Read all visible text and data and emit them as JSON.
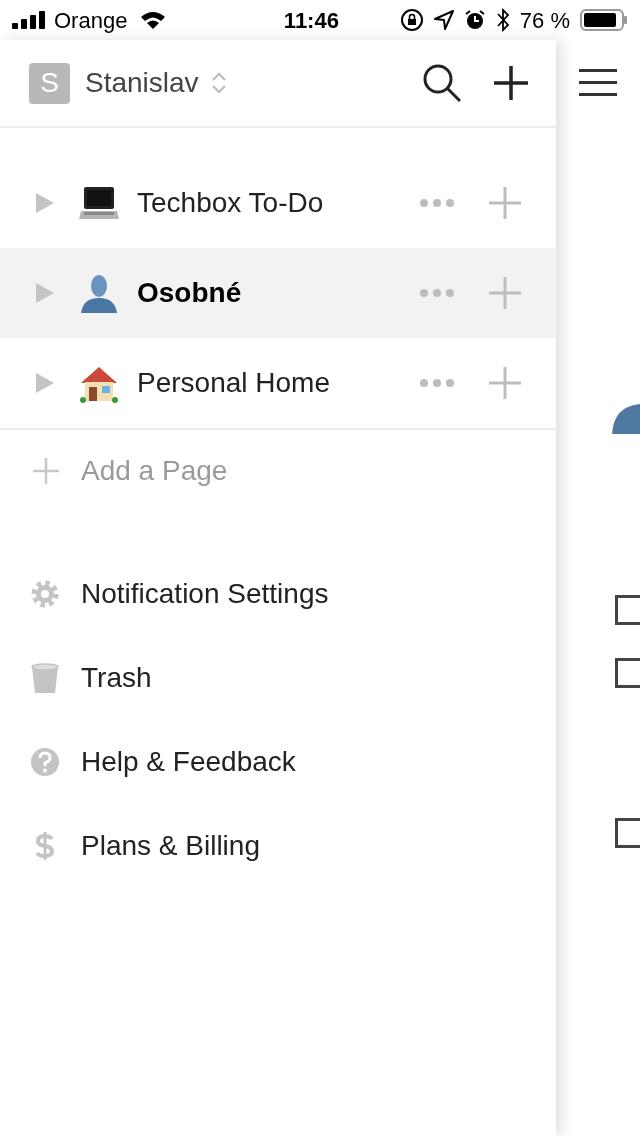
{
  "status_bar": {
    "carrier": "Orange",
    "time": "11:46",
    "battery": "76 %"
  },
  "workspace": {
    "initial": "S",
    "name": "Stanislav"
  },
  "pages": [
    {
      "title": "Techbox To-Do",
      "kind": "laptop",
      "selected": false
    },
    {
      "title": "Osobné",
      "kind": "person",
      "selected": true
    },
    {
      "title": "Personal Home",
      "kind": "house",
      "selected": false
    }
  ],
  "add_page": "Add a Page",
  "menu": [
    {
      "label": "Notification Settings",
      "kind": "gear"
    },
    {
      "label": "Trash",
      "kind": "trash"
    },
    {
      "label": "Help & Feedback",
      "kind": "help"
    },
    {
      "label": "Plans & Billing",
      "kind": "dollar"
    }
  ],
  "behind_page": {
    "checkboxes": [
      {
        "checked": false
      },
      {
        "checked": false
      },
      {
        "checked": false
      }
    ]
  }
}
